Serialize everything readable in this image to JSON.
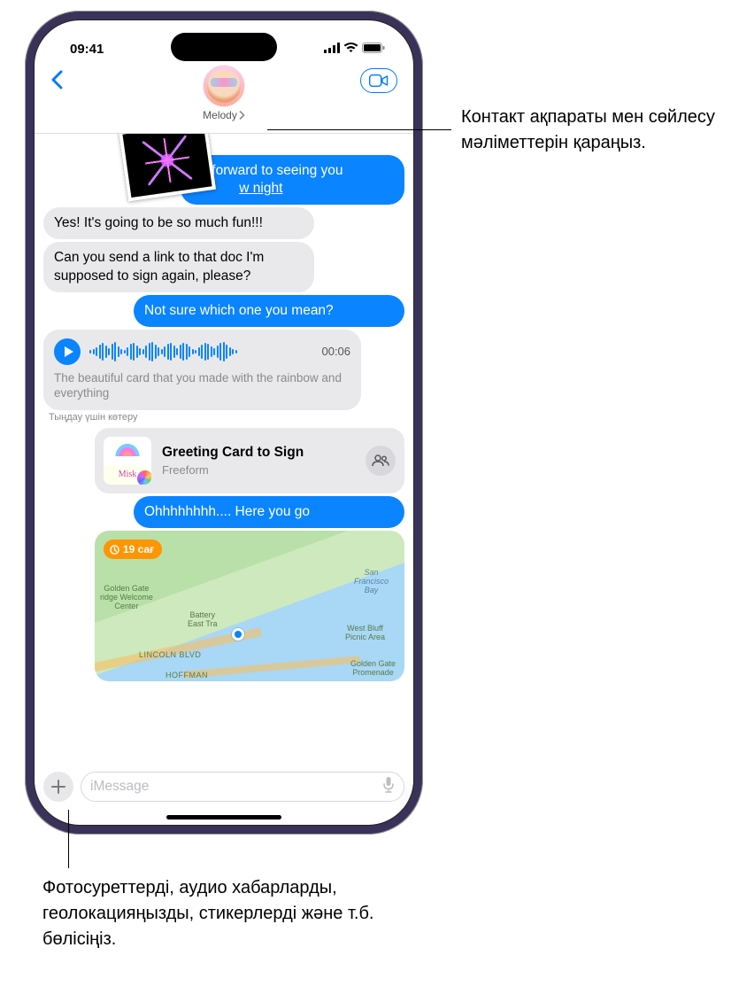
{
  "status": {
    "time": "09:41"
  },
  "contact": {
    "name": "Melody"
  },
  "messages": {
    "m1_partial": "forward to seeing you",
    "m1_link": "w night",
    "m2": "Yes! It's going to be so much fun!!!",
    "m3": "Can you send a link to that doc I'm supposed to sign again, please?",
    "m4": "Not sure which one you mean?",
    "audio_time": "00:06",
    "audio_transcript": "The beautiful card that you made with the rainbow and everything",
    "raise_to_listen": "Тыңдау үшін көтеру",
    "share_title": "Greeting Card to Sign",
    "share_sub": "Freeform",
    "share_thumb_text": "Misk",
    "m5": "Ohhhhhhhh.... Here you go"
  },
  "map": {
    "badge": "19 сағ",
    "label1": "Golden Gate",
    "label1b": "ridge Welcome",
    "label1c": "Center",
    "label2": "Battery",
    "label2b": "East Tra",
    "label3": "San",
    "label3b": "Francisco",
    "label3c": "Bay",
    "label4": "West Bluff",
    "label4b": "Picnic Area",
    "label5": "LINCOLN BLVD",
    "label6": "Golden Gate",
    "label6b": "Promenade",
    "label7": "HOFFMAN"
  },
  "input": {
    "placeholder": "iMessage"
  },
  "callouts": {
    "c1": "Контакт ақпараты мен сөйлесу мәліметтерін қараңыз.",
    "c2": "Фотосуреттерді, аудио хабарларды, геолокацияңызды, стикерлерді және т.б. бөлісіңіз."
  }
}
